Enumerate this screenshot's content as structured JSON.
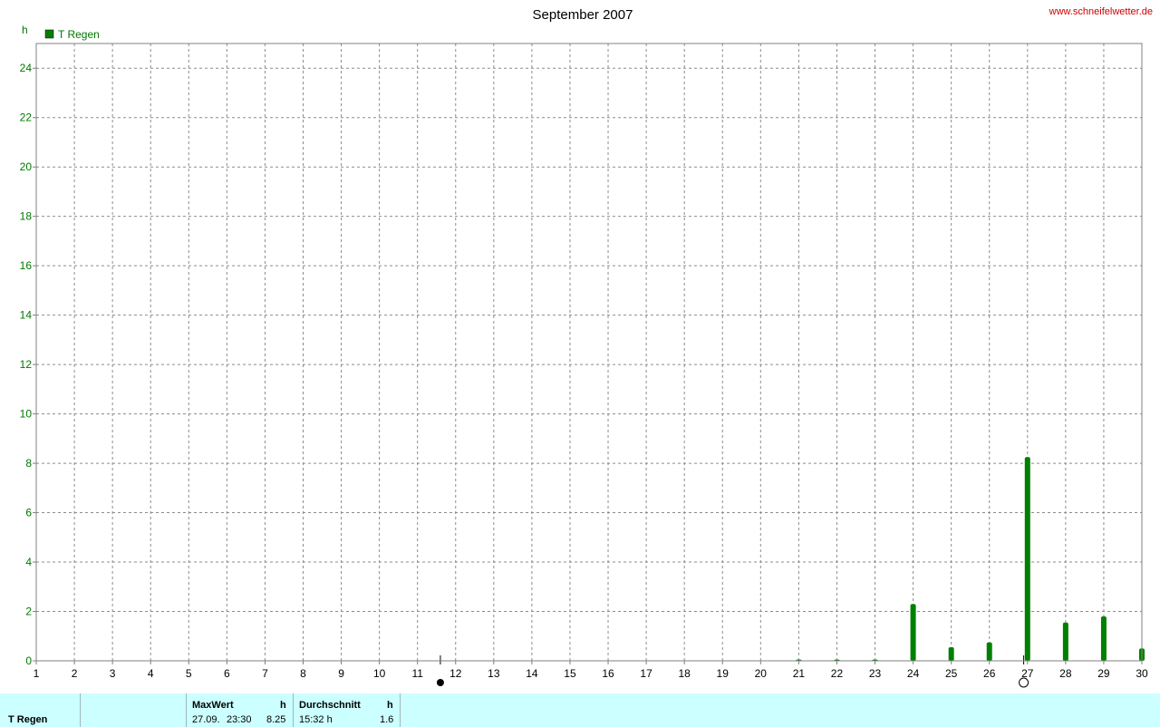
{
  "header": {
    "title": "September 2007",
    "site": "www.schneifelwetter.de"
  },
  "legend": {
    "label": "T Regen",
    "color": "#008000"
  },
  "chart_data": {
    "type": "bar",
    "title": "September 2007",
    "ylabel": "h",
    "xlabel": "",
    "ylim": [
      0,
      25
    ],
    "xlim": [
      1,
      30
    ],
    "yticks": [
      0,
      2,
      4,
      6,
      8,
      10,
      12,
      14,
      16,
      18,
      20,
      22,
      24
    ],
    "xticks": [
      1,
      2,
      3,
      4,
      5,
      6,
      7,
      8,
      9,
      10,
      11,
      12,
      13,
      14,
      15,
      16,
      17,
      18,
      19,
      20,
      21,
      22,
      23,
      24,
      25,
      26,
      27,
      28,
      29,
      30
    ],
    "grid": true,
    "legend_position": "top-left",
    "series": [
      {
        "name": "T Regen",
        "color": "#008000",
        "x": [
          21,
          22,
          23,
          24,
          25,
          26,
          27,
          28,
          29,
          30
        ],
        "values": [
          0.05,
          0.05,
          0.05,
          2.3,
          0.55,
          0.75,
          8.25,
          1.55,
          1.8,
          0.5
        ]
      }
    ],
    "moon_phases": [
      {
        "type": "new-moon",
        "day": 11.6
      },
      {
        "type": "full-moon",
        "day": 26.9
      }
    ]
  },
  "stats": {
    "series_label": "T Regen",
    "max_header": "MaxWert",
    "max_unit": "h",
    "max_date": "27.09.",
    "max_time": "23:30",
    "max_value": "8.25",
    "avg_header": "Durchschnitt",
    "avg_unit": "h",
    "avg_time": "15:32 h",
    "avg_value": "1.6"
  }
}
